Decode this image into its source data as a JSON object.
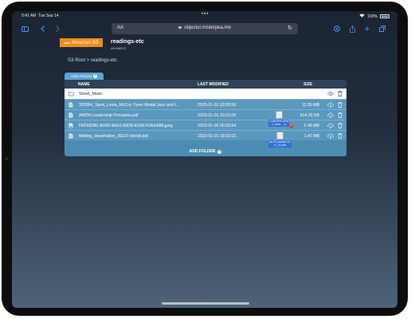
{
  "status_bar": {
    "time": "9:41 AM",
    "date": "Tue Sep 14",
    "battery": "100%"
  },
  "browser": {
    "text_size_label": "AA",
    "url": "objectui.misterpea.me",
    "accent": "#4a93f0"
  },
  "bucket": {
    "logo_prefix": "aws",
    "logo_text": "Amazon S3",
    "name": "readings-etc",
    "region": "us-east-2"
  },
  "breadcrumb": "S3-Root > readings-etc",
  "add_files_label": "ADD FILE(S)",
  "table": {
    "headers": {
      "name": "NAME",
      "modified": "LAST MODIFIED",
      "size": "SIZE"
    },
    "rows": [
      {
        "type": "folder",
        "name": "Sheet_Music",
        "modified": "",
        "size": ""
      },
      {
        "type": "file",
        "name": "302684_Sami_Linna_McCoy Tyner Modal Jazz and t...",
        "modified": "2023-01-01 19:20:56",
        "size": "13.35 MB"
      },
      {
        "type": "file",
        "name": "AMZN Leadership Principles.pdf",
        "modified": "2023-01-01 20:21:09",
        "size": "614.26 KB"
      },
      {
        "type": "file",
        "name": "FBF68380-AD00-4EE0-90DB-EF66742EE888.jpeg",
        "modified": "2023-01-26 00:33:54",
        "size": "2.48 MB"
      },
      {
        "type": "file",
        "name": "fielding_dissertation_REST-ebook.pdf",
        "modified": "2023-01-01 18:22:03",
        "size": "1.47 MB"
      }
    ]
  },
  "add_folder_label": "ADD FOLDER",
  "drag_items": {
    "first_label_line1": "LONGREVIEW",
    "first_label_line2": "2_inter..._d",
    "badge_count": "2",
    "second_label_line1": "pa-EV-whole DO",
    "second_label_line2": "K_22.pdf"
  },
  "colors": {
    "s3_orange": "#f08c1a",
    "table_blue": "#4c8cb3",
    "header_dark": "#2f4258"
  }
}
